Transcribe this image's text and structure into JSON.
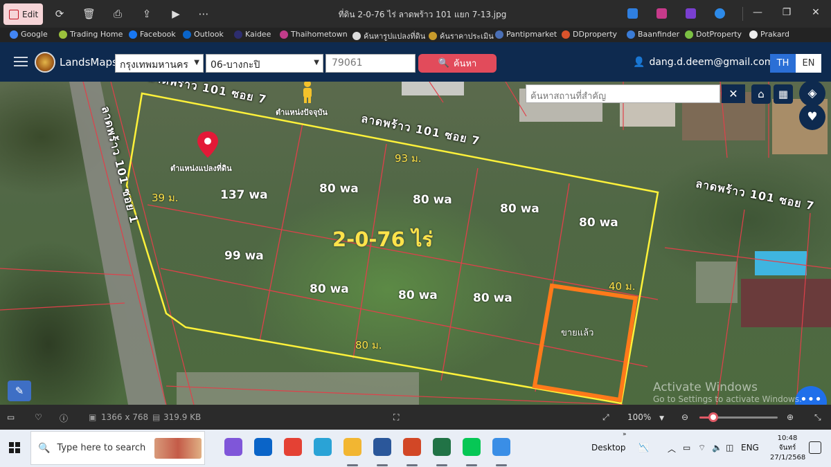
{
  "window": {
    "title": "ที่ดิน 2-0-76 ไร่ ลาดพร้าว 101 แยก 7-13.jpg",
    "edit_label": "Edit"
  },
  "bookmarks": [
    {
      "label": "Google",
      "color": "#4285f4"
    },
    {
      "label": "Trading Home",
      "color": "#9bc13c"
    },
    {
      "label": "Facebook",
      "color": "#1877f2"
    },
    {
      "label": "Outlook",
      "color": "#0a64c8"
    },
    {
      "label": "Kaidee",
      "color": "#2d2d6e"
    },
    {
      "label": "Thaihometown",
      "color": "#c03c8a"
    },
    {
      "label": "ค้นหารูปแปลงที่ดิน",
      "color": "#dddddd"
    },
    {
      "label": "ค้นราคาประเมิน",
      "color": "#c79a2b"
    },
    {
      "label": "Pantipmarket",
      "color": "#4a6fb5"
    },
    {
      "label": "DDproperty",
      "color": "#d9532c"
    },
    {
      "label": "Baanfinder",
      "color": "#3a7bd5"
    },
    {
      "label": "DotProperty",
      "color": "#7bc043"
    },
    {
      "label": "Prakard",
      "color": "#eeeeee"
    }
  ],
  "header": {
    "brand": "LandsMaps",
    "province": "กรุงเทพมหานคร",
    "district": "06-บางกะปิ",
    "parcel_placeholder": "79061",
    "search_label": "ค้นหา",
    "user_email": "dang.d.deem@gmail.com",
    "lang_th": "TH",
    "lang_en": "EN"
  },
  "map": {
    "search_placeholder": "ค้นหาสถานที่สำคัญ",
    "current_position_label": "ตำแหน่งปัจจุบัน",
    "parcel_position_label": "ตำแหน่งแปลงที่ดิน",
    "roads": {
      "top_left": "ลาดพร้าว 101 ซอย 7",
      "top_mid": "ลาดพร้าว 101 ซอย 7",
      "right": "ลาดพร้าว 101 ซอย 7",
      "left": "ลาดพร้าว 101 ซอย 1"
    },
    "total_area": "2-0-76 ไร่",
    "measurements": {
      "top": "93 ม.",
      "left": "39 ม.",
      "right": "40 ม.",
      "bottom": "80 ม."
    },
    "plots": [
      "137 wa",
      "80 wa",
      "80 wa",
      "80 wa",
      "80 wa",
      "99 wa",
      "80 wa",
      "80 wa",
      "80 wa"
    ],
    "sold_label": "ขายแล้ว",
    "colors": {
      "boundary": "#fff23a",
      "sold": "#ff7a1a",
      "parcel_lines": "#e0404a"
    },
    "watermark_title": "Activate Windows",
    "watermark_text": "Go to Settings to activate Windows."
  },
  "photos_bar": {
    "dimensions": "1366 x 768",
    "file_size": "319.9 KB",
    "zoom": "100%",
    "zoom_fraction": 0.18
  },
  "taskbar": {
    "search_placeholder": "Type here to search",
    "desktop_label": "Desktop",
    "language": "ENG",
    "time": "10:48",
    "day": "จันทร์",
    "date": "27/1/2568",
    "apps": [
      {
        "name": "copilot",
        "color": "#7f56d9"
      },
      {
        "name": "outlook",
        "color": "#0a64c8"
      },
      {
        "name": "chrome",
        "color": "#e44134"
      },
      {
        "name": "edge",
        "color": "#2aa3d6"
      },
      {
        "name": "file-explorer",
        "color": "#f2b632"
      },
      {
        "name": "word",
        "color": "#2b579a"
      },
      {
        "name": "powerpoint",
        "color": "#d24726"
      },
      {
        "name": "excel",
        "color": "#217346"
      },
      {
        "name": "line",
        "color": "#06c755"
      },
      {
        "name": "photos",
        "color": "#3a8ee6"
      }
    ]
  }
}
